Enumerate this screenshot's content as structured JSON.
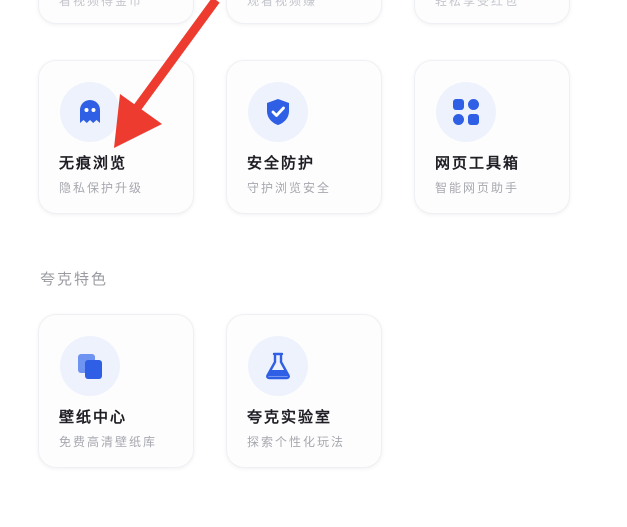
{
  "colors": {
    "accent": "#2f5fe4",
    "icon_bg": "#eef2fc",
    "arrow": "#ee3b30"
  },
  "top_row": [
    {
      "subtitle": "看视频得金币"
    },
    {
      "subtitle": "观看视频赚"
    },
    {
      "subtitle": "轻松享受红包"
    }
  ],
  "tools": [
    {
      "title": "无痕浏览",
      "subtitle": "隐私保护升级",
      "icon": "ghost-icon"
    },
    {
      "title": "安全防护",
      "subtitle": "守护浏览安全",
      "icon": "shield-check-icon"
    },
    {
      "title": "网页工具箱",
      "subtitle": "智能网页助手",
      "icon": "apps-grid-icon"
    }
  ],
  "features_section": {
    "title": "夸克特色",
    "items": [
      {
        "title": "壁纸中心",
        "subtitle": "免费高清壁纸库",
        "icon": "wallpaper-icon"
      },
      {
        "title": "夸克实验室",
        "subtitle": "探索个性化玩法",
        "icon": "flask-icon"
      }
    ]
  }
}
